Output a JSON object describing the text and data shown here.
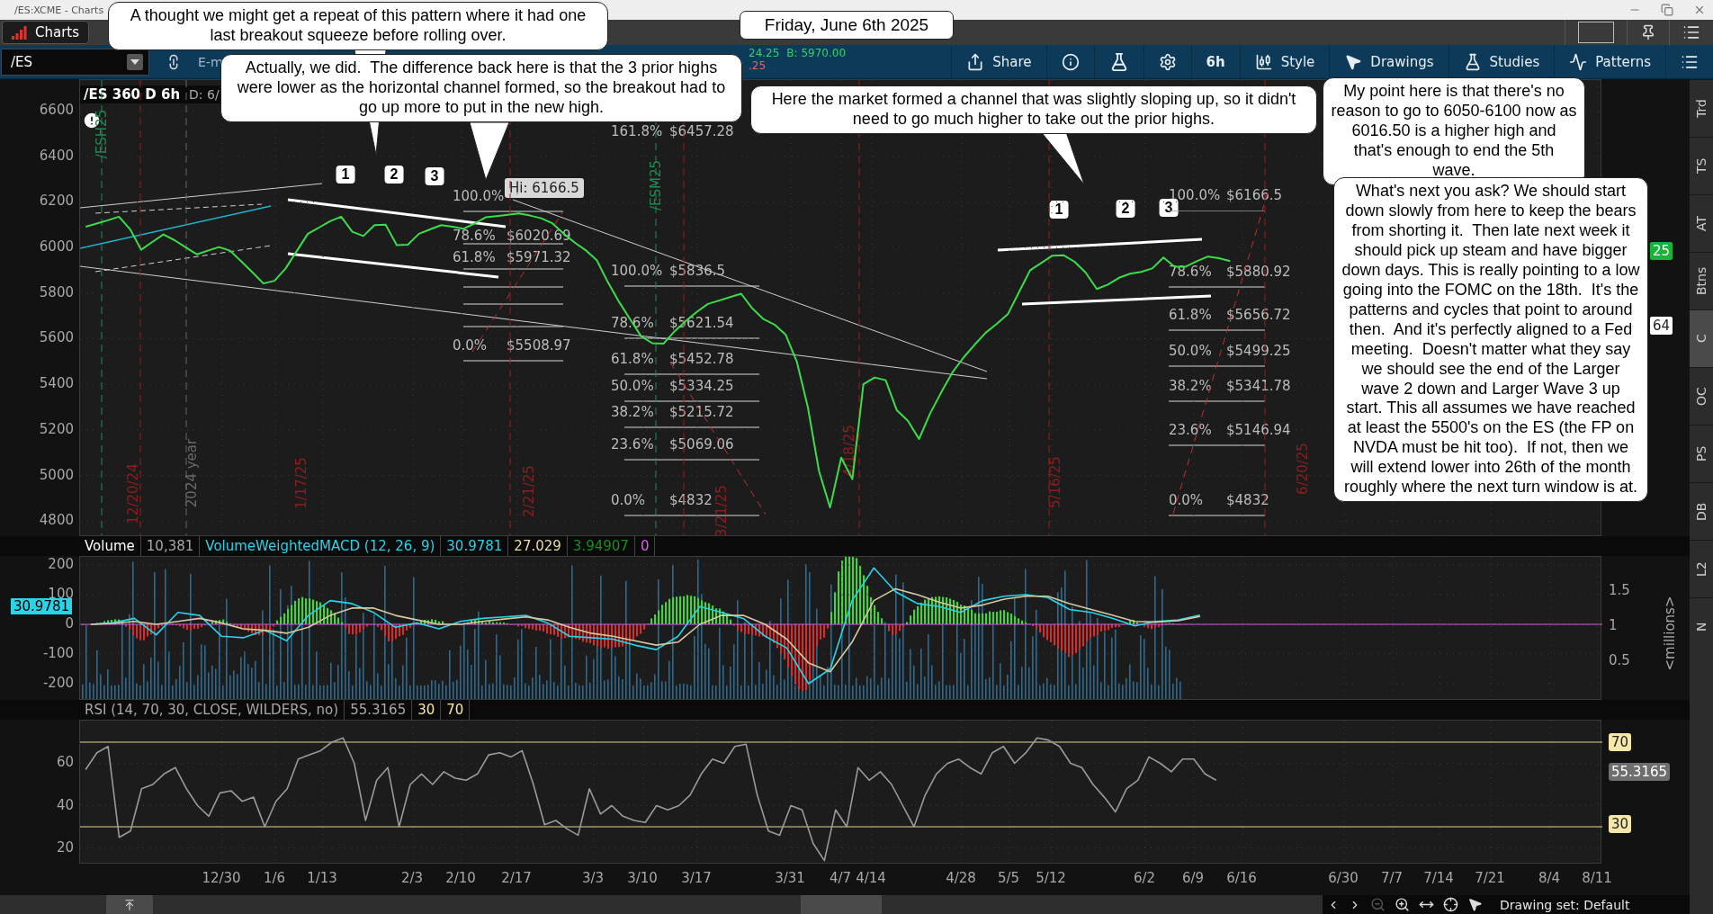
{
  "window": {
    "title": "/ES:XCME - Charts"
  },
  "tab": {
    "label": "Charts"
  },
  "toolbar": {
    "symbol": "/ES",
    "description": "E-m",
    "quotes": [
      {
        "text": "24.25",
        "kind": "up"
      },
      {
        "text": "B: 5970.00",
        "kind": "up"
      },
      {
        "text": ".25",
        "kind": "down"
      }
    ],
    "buttons": [
      {
        "kind": "share",
        "label": "Share"
      },
      {
        "kind": "info"
      },
      {
        "kind": "flask"
      },
      {
        "kind": "gear"
      },
      {
        "kind": "interval",
        "label": "6h"
      },
      {
        "kind": "style",
        "label": "Style"
      },
      {
        "kind": "drawings",
        "label": "Drawings"
      },
      {
        "kind": "studies",
        "label": "Studies"
      },
      {
        "kind": "patterns",
        "label": "Patterns"
      },
      {
        "kind": "menu"
      }
    ]
  },
  "date_note": "Friday, June 6th 2025",
  "callouts": [
    "A thought we might get a repeat of this pattern where it had one last breakout squeeze before rolling over.",
    "Actually, we did.  The difference back here is that the 3 prior highs were lower as the horizontal channel formed, so the breakout had to go up more to put in the new high.",
    "Here the market formed a channel that was slightly sloping up, so it didn't need to go much higher to take out the prior highs.",
    "My point here is that there's no reason to go to 6050-6100 now as 6016.50 is a higher high and that's enough to end the 5th wave.",
    "What's next you ask? We should start down slowly from here to keep the bears from shorting it.  Then late next week it should pick up steam and have bigger down days. This is really pointing to a low going into the FOMC on the 18th.  It's the patterns and cycles that point to around then.  And it's perfectly aligned to a Fed meeting.  Doesn't matter what they say we should see the end of the Larger wave 2 down and Larger Wave 3 up start. This all assumes we have reached at least the 5500's on the ES (the FP on NVDA must be hit too).  If not, then we will extend lower into 26th of the month roughly where the next turn window is at."
  ],
  "chart": {
    "header": "/ES 360 D 6h",
    "detail": "D: 6/",
    "markers": [
      {
        "text": "/ESH25",
        "kind": "expiry"
      },
      {
        "text": "12/20/24",
        "kind": "cycle"
      },
      {
        "text": "2024 year",
        "kind": "year"
      },
      {
        "text": "1/17/25",
        "kind": "cycle"
      },
      {
        "text": "2/21/25",
        "kind": "cycle"
      },
      {
        "text": "/ESM25",
        "kind": "expiry"
      },
      {
        "text": "3/21/25",
        "kind": "cycle"
      },
      {
        "text": "4/18/25",
        "kind": "cycle"
      },
      {
        "text": "5/16/25",
        "kind": "cycle"
      },
      {
        "text": "6/20/25",
        "kind": "cycle"
      }
    ],
    "wave_labels": [
      "1",
      "2",
      "3",
      "1",
      "2",
      "3"
    ],
    "high_tag": "Hi: 6166.5",
    "fib_sets": [
      {
        "levels": [
          {
            "percent": "100.0%"
          },
          {
            "percent": "78.6%",
            "price": "$6020.69"
          },
          {
            "percent": "61.8%",
            "price": "$5971.32"
          },
          {
            "percent": "0.0%",
            "price": "$5508.97"
          }
        ]
      },
      {
        "levels": [
          {
            "percent": "161.8%",
            "price": "$6457.28"
          },
          {
            "percent": "100.0%",
            "price": "$5836.5"
          },
          {
            "percent": "78.6%",
            "price": "$5621.54"
          },
          {
            "percent": "61.8%",
            "price": "$5452.78"
          },
          {
            "percent": "50.0%",
            "price": "$5334.25"
          },
          {
            "percent": "38.2%",
            "price": "$5215.72"
          },
          {
            "percent": "23.6%",
            "price": "$5069.06"
          },
          {
            "percent": "0.0%",
            "price": "$4832"
          }
        ]
      },
      {
        "levels": [
          {
            "percent": "100.0%",
            "price": "$6166.5"
          },
          {
            "percent": "78.6%",
            "price": "$5880.92"
          },
          {
            "percent": "61.8%",
            "price": "$5656.72"
          },
          {
            "percent": "50.0%",
            "price": "$5499.25"
          },
          {
            "percent": "38.2%",
            "price": "$5341.78"
          },
          {
            "percent": "23.6%",
            "price": "$5146.94"
          },
          {
            "percent": "0.0%",
            "price": "$4832"
          }
        ]
      }
    ],
    "price_tags": [
      {
        "text": "25",
        "kind": "last"
      },
      {
        "text": "64",
        "kind": "mark"
      }
    ],
    "chart_data": {
      "type": "line",
      "yticks": [
        6600,
        6400,
        6200,
        6000,
        5800,
        5600,
        5400,
        5200,
        5000,
        4800
      ],
      "ylim": [
        4738,
        6734
      ],
      "grid": true,
      "series": [
        {
          "color": "#3ddc4a",
          "values": [
            6091,
            6105,
            6119,
            6135,
            6080,
            5990,
            6024,
            6057,
            6032,
            6001,
            5970,
            5986,
            6002,
            5986,
            5939,
            5892,
            5842,
            5854,
            5908,
            5984,
            6060,
            6087,
            6115,
            6135,
            6069,
            6050,
            6098,
            6100,
            6010,
            6012,
            6060,
            6079,
            6098,
            6091,
            6082,
            6105,
            6132,
            6137,
            6143,
            6149,
            6140,
            6128,
            6106,
            6062,
            6022,
            5988,
            5944,
            5848,
            5762,
            5686,
            5610,
            5580,
            5578,
            5632,
            5677,
            5717,
            5752,
            5767,
            5782,
            5797,
            5733,
            5686,
            5662,
            5618,
            5500,
            5300,
            5020,
            4860,
            5078,
            4984,
            5400,
            5430,
            5418,
            5286,
            5240,
            5160,
            5272,
            5365,
            5451,
            5517,
            5573,
            5626,
            5665,
            5708,
            5804,
            5900,
            5932,
            5964,
            5966,
            5937,
            5890,
            5818,
            5837,
            5867,
            5885,
            5893,
            5908,
            5956,
            5916,
            5916,
            5940,
            5960,
            5953,
            5940,
            null,
            null,
            null,
            null,
            null,
            null,
            null,
            null,
            null,
            null,
            null,
            null,
            null,
            null,
            null,
            null,
            null,
            null,
            null,
            null,
            null,
            null,
            null,
            null,
            null,
            null,
            null,
            null,
            null,
            null,
            null,
            null,
            null
          ]
        }
      ]
    }
  },
  "volume": {
    "header": [
      {
        "text": "Volume",
        "kind": "name"
      },
      {
        "text": "10,381",
        "kind": "value"
      },
      {
        "text": "VolumeWeightedMACD (12, 26, 9)",
        "kind": "macd"
      },
      {
        "text": "30.9781",
        "kind": "macd"
      },
      {
        "text": "27.029",
        "kind": "avg"
      },
      {
        "text": "3.94907",
        "kind": "diff"
      },
      {
        "text": "0",
        "kind": "zero"
      }
    ],
    "right_axis": [
      "1.5",
      "1",
      "0.5"
    ],
    "unit": "<millions>",
    "tag": "30.9781",
    "chart_data": {
      "type": "line",
      "yticks": [
        200,
        100,
        0,
        -100,
        -200
      ],
      "ylim": [
        -251.5,
        227.3
      ],
      "grid": true,
      "series": [
        {
          "color": "#27d4e8",
          "values": [
            0,
            5,
            20,
            -35,
            40,
            30,
            -40,
            -45,
            -20,
            -55,
            30,
            80,
            70,
            40,
            -10,
            5,
            -15,
            10,
            20,
            25,
            30,
            5,
            -40,
            -45,
            -50,
            -70,
            -85,
            -40,
            60,
            40,
            20,
            -40,
            -80,
            -200,
            -150,
            80,
            190,
            110,
            70,
            60,
            40,
            80,
            95,
            100,
            90,
            50,
            40,
            20,
            -5,
            10,
            15,
            31,
            null,
            null,
            null,
            null,
            null,
            null,
            null,
            null,
            null,
            null,
            null,
            null,
            null,
            null,
            null,
            null,
            null,
            null
          ]
        },
        {
          "color": "#d8c8a0",
          "values": [
            0,
            3,
            10,
            0,
            10,
            20,
            5,
            -15,
            -20,
            -30,
            -10,
            30,
            55,
            55,
            30,
            15,
            0,
            0,
            10,
            18,
            25,
            15,
            -10,
            -30,
            -40,
            -55,
            -70,
            -60,
            0,
            30,
            30,
            0,
            -50,
            -130,
            -160,
            -60,
            80,
            120,
            100,
            75,
            55,
            65,
            85,
            95,
            95,
            70,
            50,
            30,
            10,
            8,
            12,
            27,
            null,
            null,
            null,
            null,
            null,
            null,
            null,
            null,
            null,
            null,
            null,
            null,
            null,
            null,
            null,
            null,
            null,
            null
          ]
        }
      ]
    }
  },
  "rsi": {
    "header": [
      {
        "text": "RSI (14, 70, 30, CLOSE, WILDERS, no)",
        "kind": "value"
      },
      {
        "text": "55.3165",
        "kind": "value"
      },
      {
        "text": "30",
        "kind": "level"
      },
      {
        "text": "70",
        "kind": "level"
      }
    ],
    "chart_data": {
      "type": "line",
      "yticks": [
        60,
        40,
        20
      ],
      "ylim": [
        13,
        80.2
      ],
      "grid": true,
      "series": [
        {
          "color": "#9a9a9a",
          "values": [
            57,
            65,
            68,
            25,
            28,
            48,
            50,
            55,
            58,
            48,
            40,
            35,
            46,
            47,
            42,
            44,
            30,
            42,
            48,
            62,
            64,
            66,
            70,
            72,
            60,
            33,
            52,
            58,
            30,
            50,
            55,
            50,
            56,
            53,
            52,
            55,
            64,
            65,
            63,
            66,
            50,
            31,
            33,
            29,
            26,
            48,
            36,
            40,
            35,
            33,
            32,
            40,
            38,
            40,
            45,
            55,
            62,
            60,
            68,
            69,
            45,
            28,
            26,
            40,
            38,
            22,
            14,
            38,
            30,
            58,
            52,
            56,
            50,
            40,
            30,
            45,
            55,
            60,
            62,
            58,
            55,
            65,
            68,
            60,
            65,
            72,
            71,
            68,
            60,
            58,
            50,
            44,
            37,
            48,
            52,
            63,
            60,
            56,
            62,
            62,
            55,
            52,
            null,
            null,
            null,
            null,
            null,
            null,
            null,
            null,
            null,
            null,
            null,
            null,
            null,
            null,
            null,
            null,
            null,
            null,
            null,
            null,
            null,
            null,
            null,
            null,
            null,
            null,
            null,
            null,
            null,
            null,
            null,
            null,
            null,
            null
          ]
        }
      ]
    },
    "tags": [
      {
        "text": "70",
        "kind": "level"
      },
      {
        "text": "55.3165",
        "kind": "value"
      },
      {
        "text": "30",
        "kind": "level"
      }
    ]
  },
  "dates": [
    "12/30",
    "1/6",
    "1/13",
    "2/3",
    "2/10",
    "2/17",
    "3/3",
    "3/10",
    "3/17",
    "3/31",
    "4/7",
    "4/14",
    "4/28",
    "5/5",
    "5/12",
    "6/2",
    "6/9",
    "6/16",
    "6/30",
    "7/7",
    "7/14",
    "7/21",
    "8/4",
    "8/11"
  ],
  "status_bar": {
    "drawing_set": "Drawing set: Default"
  },
  "sidebar_tabs": [
    {
      "label": "Trd",
      "selected": false
    },
    {
      "label": "TS",
      "selected": false
    },
    {
      "label": "AT",
      "selected": false
    },
    {
      "label": "Btns",
      "selected": false
    },
    {
      "label": "C",
      "selected": true
    },
    {
      "label": "OC",
      "selected": false
    },
    {
      "label": "PS",
      "selected": false
    },
    {
      "label": "DB",
      "selected": false
    },
    {
      "label": "L2",
      "selected": false
    },
    {
      "label": "N",
      "selected": false
    }
  ]
}
